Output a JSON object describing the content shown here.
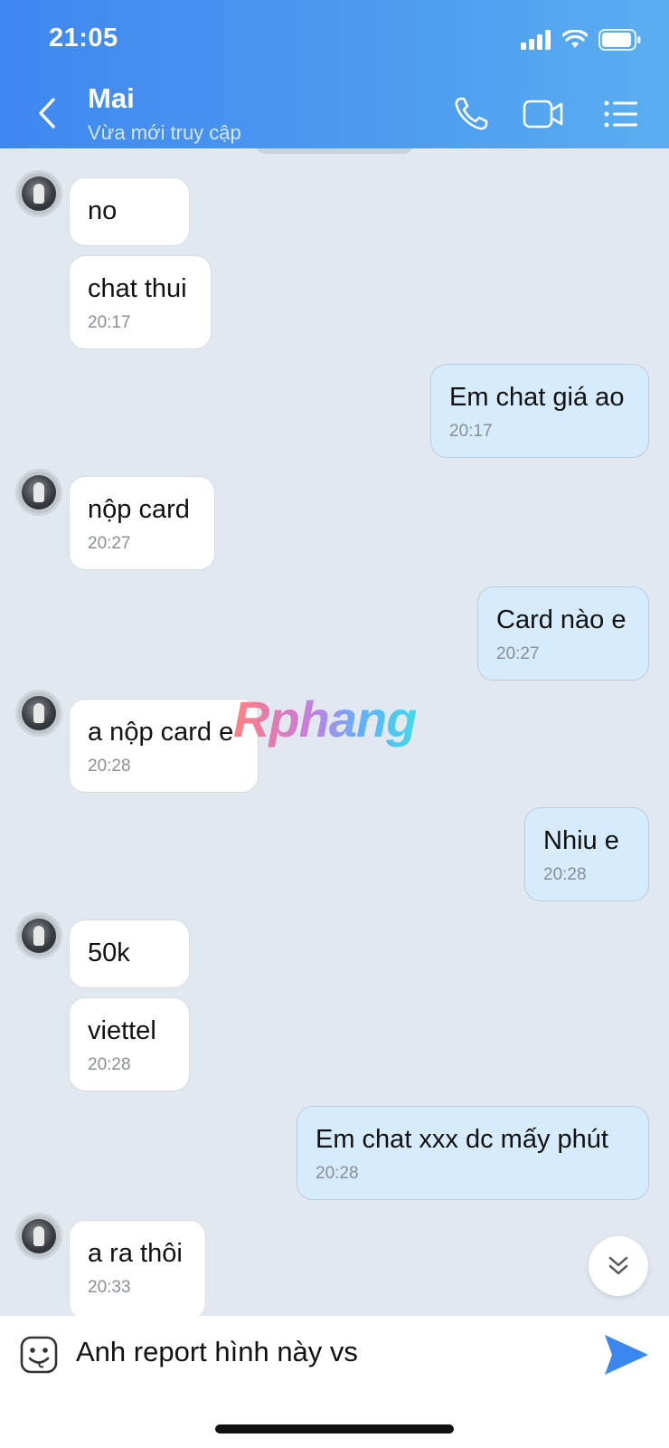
{
  "status_bar": {
    "time": "21:05"
  },
  "header": {
    "contact_name": "Mai",
    "contact_status": "Vừa mới truy cập",
    "icons": [
      "back-icon",
      "phone-icon",
      "video-icon",
      "menu-list-icon"
    ]
  },
  "messages": [
    {
      "dir": "in",
      "text": "no",
      "time": ""
    },
    {
      "dir": "in",
      "text": "chat thui",
      "time": "20:17"
    },
    {
      "dir": "out",
      "text": "Em chat giá ao",
      "time": "20:17"
    },
    {
      "dir": "in",
      "text": "nộp card",
      "time": "20:27"
    },
    {
      "dir": "out",
      "text": "Card nào e",
      "time": "20:27"
    },
    {
      "dir": "in",
      "text": "a nộp card e",
      "time": "20:28"
    },
    {
      "dir": "out",
      "text": "Nhiu e",
      "time": "20:28"
    },
    {
      "dir": "in",
      "text": "50k",
      "time": ""
    },
    {
      "dir": "in",
      "text": "viettel",
      "time": "20:28"
    },
    {
      "dir": "out",
      "text": "Em chat xxx dc mấy phút",
      "time": "20:28"
    },
    {
      "dir": "in",
      "text": "a ra thôi",
      "time": "20:33"
    }
  ],
  "watermark": "Rphang",
  "composer": {
    "value": "Anh report hình này vs"
  },
  "colors": {
    "header_start": "#3f87f0",
    "header_end": "#5aaef0",
    "outgoing_bubble": "#d6ebfb",
    "background": "#e2e8f0",
    "send": "#3b87f0"
  }
}
